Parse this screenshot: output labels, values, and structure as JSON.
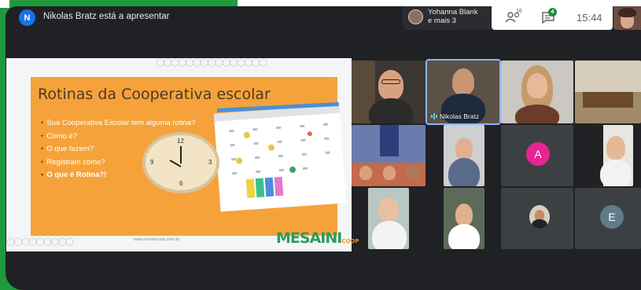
{
  "presenter": {
    "initial": "N",
    "text": "Nikolas Bratz está a apresentar"
  },
  "active_speaker": {
    "line1": "Yohanna Blank",
    "line2": "e mais 3"
  },
  "meeting": {
    "participant_count": "16",
    "chat_badge": "4",
    "time": "15:44"
  },
  "slide": {
    "title": "Rotinas da Cooperativa escolar",
    "bullets": [
      "Sua Cooperativa Escolar tem alguma rotina?",
      "Como é?",
      "O que fazem?",
      "Registram como?",
      "O que é Rotina?!"
    ],
    "website": "www.mannicoop.com.br",
    "logo_main": "MESAINI",
    "logo_sub": "COOP",
    "clock_numbers": [
      "12",
      "3",
      "6",
      "9"
    ]
  },
  "tiles": [
    {
      "name": "",
      "type": "video",
      "icon": "person-video"
    },
    {
      "name": "Nikolas Bratz",
      "type": "video",
      "icon": "person-video"
    },
    {
      "name": "",
      "type": "video",
      "icon": "person-video"
    },
    {
      "name": "",
      "type": "video",
      "icon": "room-video"
    },
    {
      "name": "",
      "type": "video",
      "icon": "group-video"
    },
    {
      "name": "",
      "type": "video",
      "icon": "person-video"
    },
    {
      "name": "",
      "type": "avatar",
      "letter": "A",
      "color": "#e52592"
    },
    {
      "name": "",
      "type": "video",
      "icon": "person-video"
    },
    {
      "name": "",
      "type": "video",
      "icon": "person-video"
    },
    {
      "name": "",
      "type": "video",
      "icon": "person-video"
    },
    {
      "name": "",
      "type": "video",
      "icon": "person-small"
    },
    {
      "name": "",
      "type": "avatar",
      "letter": "E",
      "color": "#5f7c8a"
    }
  ],
  "colors": {
    "frame_green": "#1f9a3c",
    "meet_dark": "#202124",
    "slide_orange": "#f6a23b",
    "avatar_pink": "#e52592",
    "avatar_slate": "#5f7c8a",
    "presenter_blue": "#1a73e8"
  }
}
